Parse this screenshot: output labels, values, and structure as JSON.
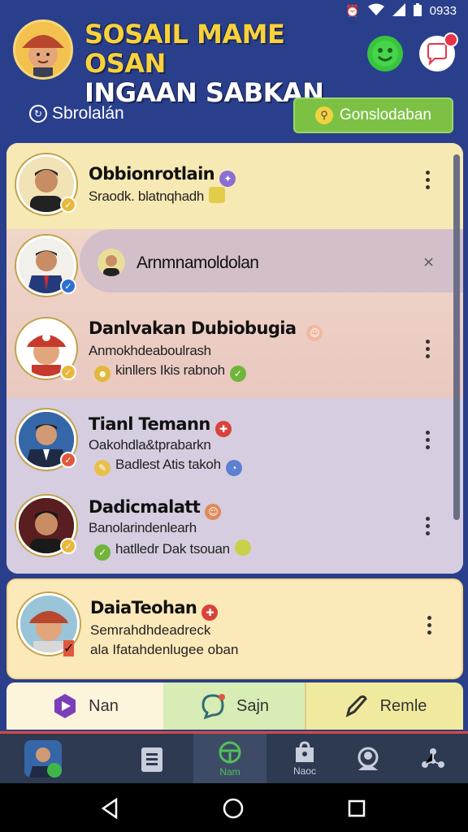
{
  "status_bar": {
    "time": "0933"
  },
  "header": {
    "title_line1": "SOSAIL MAME OSAN",
    "title_line2": "INGAAN SABKAN"
  },
  "subheader": {
    "refresh_label": "Sbrolalán",
    "search_label": "Gonslodaban"
  },
  "contacts": [
    {
      "name": "Obbionrotlain",
      "line1": "Sraodk. blatnqhadh",
      "line2": ""
    },
    {
      "name": "Arnmnamoldolan",
      "line1": "",
      "line2": ""
    },
    {
      "name": "Danlvakan Dubiobugia",
      "line1": "Anmokhdeaboulrash",
      "line2": "kinllers Ikis rabnoh"
    },
    {
      "name": "Tianl Temann",
      "line1": "Oakohdla&tprabarkn",
      "line2": "Badlest Atis takoh"
    },
    {
      "name": "Dadicmalatt",
      "line1": "Banolarindenlearh",
      "line2": "hatlledr Dak tsouan"
    },
    {
      "name": "DaiaTeohan",
      "line1": "Semrahdhdeadreck",
      "line2": "ala Ifatahdenlugee oban"
    }
  ],
  "segments": [
    {
      "label": "Nan"
    },
    {
      "label": "Sajn"
    },
    {
      "label": "Remle"
    }
  ],
  "bottom_nav": {
    "active_label": "Nam",
    "item4_label": "Naoc"
  },
  "colors": {
    "background": "#2a3f8c",
    "title_yellow": "#f7d23a",
    "search_green": "#7cc144",
    "badge_red": "#e8334a"
  }
}
